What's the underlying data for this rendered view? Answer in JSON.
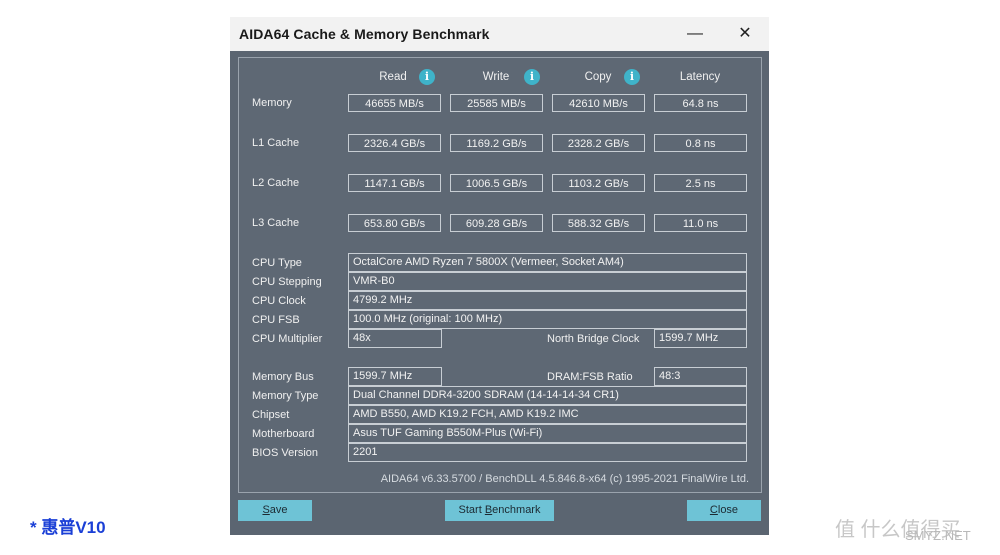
{
  "window": {
    "title": "AIDA64 Cache & Memory Benchmark",
    "minimize": "—",
    "close": "✕"
  },
  "columns": {
    "read": "Read",
    "write": "Write",
    "copy": "Copy",
    "latency": "Latency",
    "info_glyph": "i"
  },
  "bench_rows": [
    {
      "label": "Memory",
      "read": "46655 MB/s",
      "write": "25585 MB/s",
      "copy": "42610 MB/s",
      "latency": "64.8 ns"
    },
    {
      "label": "L1 Cache",
      "read": "2326.4 GB/s",
      "write": "1169.2 GB/s",
      "copy": "2328.2 GB/s",
      "latency": "0.8 ns"
    },
    {
      "label": "L2 Cache",
      "read": "1147.1 GB/s",
      "write": "1006.5 GB/s",
      "copy": "1103.2 GB/s",
      "latency": "2.5 ns"
    },
    {
      "label": "L3 Cache",
      "read": "653.80 GB/s",
      "write": "609.28 GB/s",
      "copy": "588.32 GB/s",
      "latency": "11.0 ns"
    }
  ],
  "cpu": {
    "type_label": "CPU Type",
    "type": "OctalCore AMD Ryzen 7 5800X  (Vermeer, Socket AM4)",
    "stepping_label": "CPU Stepping",
    "stepping": "VMR-B0",
    "clock_label": "CPU Clock",
    "clock": "4799.2 MHz",
    "fsb_label": "CPU FSB",
    "fsb": "100.0 MHz  (original: 100 MHz)",
    "multiplier_label": "CPU Multiplier",
    "multiplier": "48x",
    "nb_clock_label": "North Bridge Clock",
    "nb_clock": "1599.7 MHz"
  },
  "memory": {
    "bus_label": "Memory Bus",
    "bus": "1599.7 MHz",
    "ratio_label": "DRAM:FSB Ratio",
    "ratio": "48:3",
    "type_label": "Memory Type",
    "type": "Dual Channel DDR4-3200 SDRAM  (14-14-14-34 CR1)",
    "chipset_label": "Chipset",
    "chipset": "AMD B550, AMD K19.2 FCH, AMD K19.2 IMC",
    "motherboard_label": "Motherboard",
    "motherboard": "Asus TUF Gaming B550M-Plus (Wi-Fi)",
    "bios_label": "BIOS Version",
    "bios": "2201"
  },
  "footer": "AIDA64 v6.33.5700 / BenchDLL 4.5.846.8-x64  (c) 1995-2021 FinalWire Ltd.",
  "buttons": {
    "save_u": "S",
    "save_rest": "ave",
    "start_pre": "Start ",
    "start_u": "B",
    "start_rest": "enchmark",
    "close_u": "C",
    "close_rest": "lose"
  },
  "watermarks": {
    "left": "* 惠普V10",
    "right": "值 什么值得买",
    "url": "SMYZ.NET"
  }
}
